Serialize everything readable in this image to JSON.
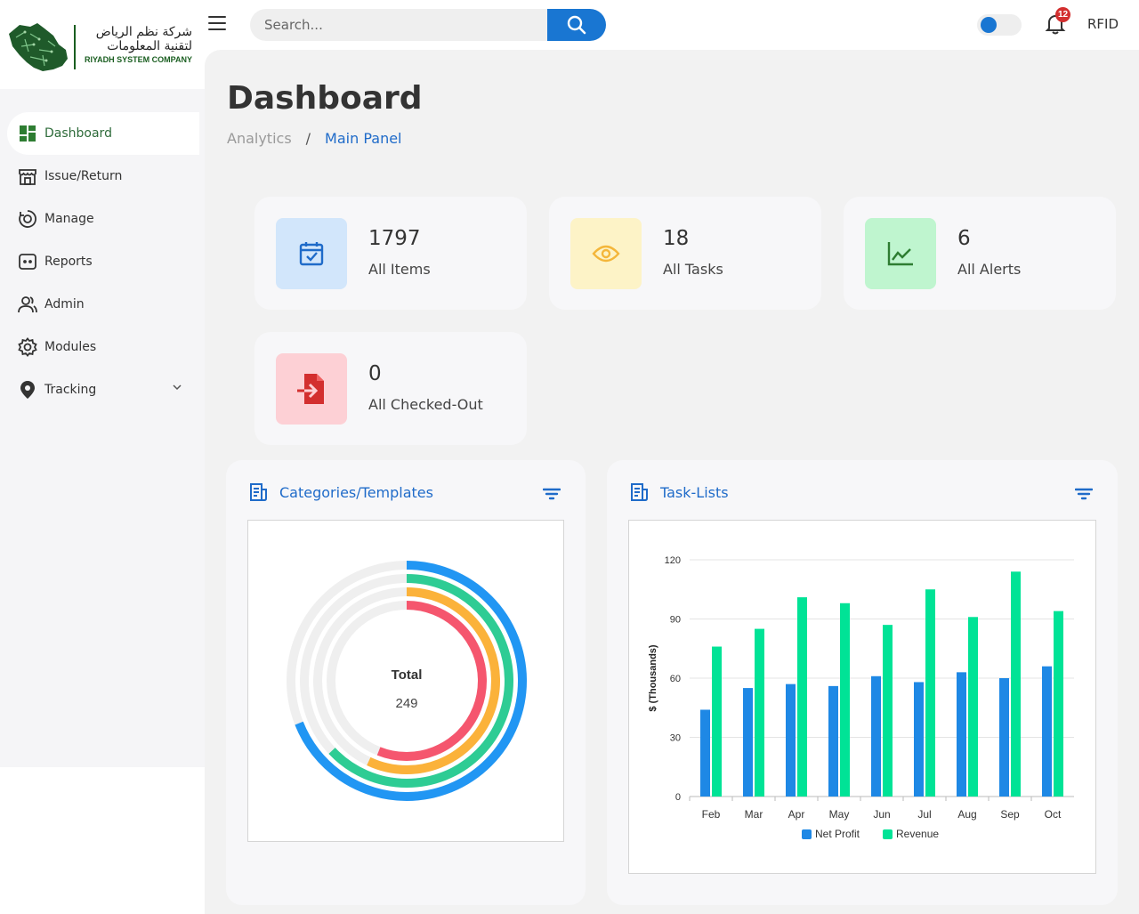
{
  "brand": {
    "arabic_line1": "شركة نظم الرياض",
    "arabic_line2": "لتقنية المعلومات",
    "english": "RIYADH SYSTEM COMPANY"
  },
  "sidebar": {
    "items": [
      {
        "label": "Dashboard",
        "icon": "dashboard-icon",
        "active": true
      },
      {
        "label": "Issue/Return",
        "icon": "store-icon"
      },
      {
        "label": "Manage",
        "icon": "manage-icon"
      },
      {
        "label": "Reports",
        "icon": "reports-icon"
      },
      {
        "label": "Admin",
        "icon": "admin-icon"
      },
      {
        "label": "Modules",
        "icon": "gear-icon"
      },
      {
        "label": "Tracking",
        "icon": "location-pin-icon"
      }
    ]
  },
  "header": {
    "search_placeholder": "Search...",
    "notification_count": "12",
    "user_label": "RFID"
  },
  "page": {
    "title": "Dashboard",
    "breadcrumb": [
      "Analytics",
      "/",
      "Main Panel"
    ]
  },
  "stats": [
    {
      "value": "1797",
      "label": "All Items",
      "icon": "calendar-check-icon"
    },
    {
      "value": "18",
      "label": "All Tasks",
      "icon": "eye-icon"
    },
    {
      "value": "6",
      "label": "All Alerts",
      "icon": "line-chart-icon"
    },
    {
      "value": "0",
      "label": "All Checked-Out",
      "icon": "file-export-icon"
    }
  ],
  "panels": {
    "categories_title": "Categories/Templates",
    "tasks_title": "Task-Lists"
  },
  "colors": {
    "accent_blue": "#1976d2",
    "brand_green": "#2e6b3a",
    "series_blue": "#1e88e5",
    "series_green": "#00e396",
    "ring_colors": [
      "#2196f3",
      "#2ecc94",
      "#fbb23a",
      "#f5566e"
    ]
  },
  "chart_data": [
    {
      "type": "radialBar",
      "total_label": "Total",
      "total_value": "249",
      "rings_fraction": [
        0.69,
        0.63,
        0.57,
        0.56
      ]
    },
    {
      "type": "bar",
      "categories": [
        "Feb",
        "Mar",
        "Apr",
        "May",
        "Jun",
        "Jul",
        "Aug",
        "Sep",
        "Oct"
      ],
      "series": [
        {
          "name": "Net Profit",
          "values": [
            44,
            55,
            57,
            56,
            61,
            58,
            63,
            60,
            66
          ]
        },
        {
          "name": "Revenue",
          "values": [
            76,
            85,
            101,
            98,
            87,
            105,
            91,
            114,
            94
          ]
        }
      ],
      "ylabel": "$ (Thousands)",
      "ylim": [
        0,
        120
      ],
      "yticks": [
        "0",
        "30",
        "60",
        "90",
        "120"
      ],
      "legend": "bottom-center",
      "grid": true
    }
  ]
}
